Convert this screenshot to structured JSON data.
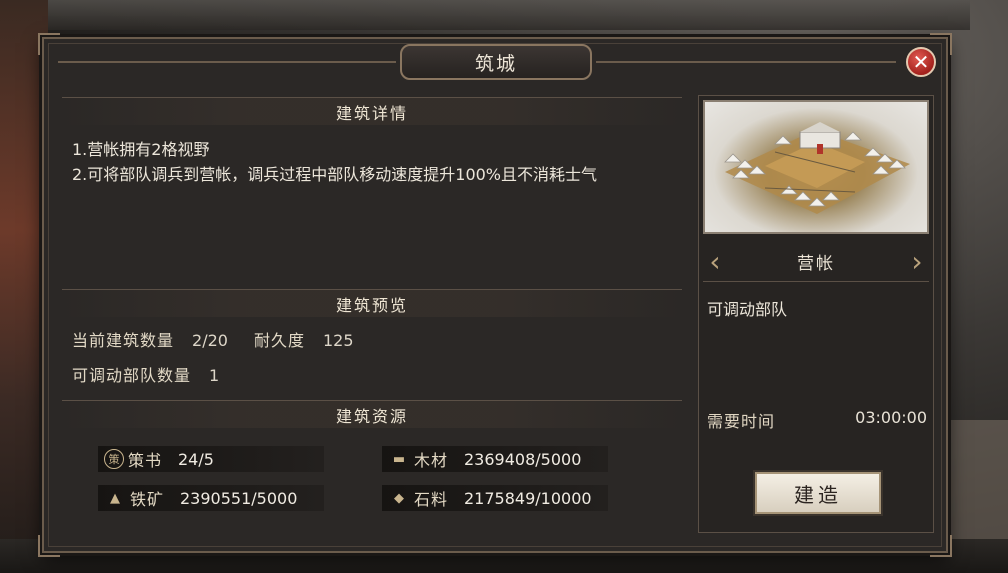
{
  "dialog": {
    "title": "筑城",
    "close_label": "✕"
  },
  "details": {
    "heading": "建筑详情",
    "lines": [
      "1.营帐拥有2格视野",
      "2.可将部队调兵到营帐，调兵过程中部队移动速度提升100%且不消耗士气"
    ]
  },
  "preview": {
    "heading": "建筑预览",
    "count_label": "当前建筑数量",
    "count_value": "2/20",
    "durability_label": "耐久度",
    "durability_value": "125",
    "troops_label": "可调动部队数量",
    "troops_value": "1"
  },
  "resources": {
    "heading": "建筑资源",
    "items": [
      {
        "icon": "decree-icon",
        "glyph": "策",
        "name": "策书",
        "value": "24/5"
      },
      {
        "icon": "wood-icon",
        "glyph": "▬",
        "name": "木材",
        "value": "2369408/5000"
      },
      {
        "icon": "iron-icon",
        "glyph": "▲",
        "name": "铁矿",
        "value": "2390551/5000"
      },
      {
        "icon": "stone-icon",
        "glyph": "◆",
        "name": "石料",
        "value": "2175849/10000"
      }
    ]
  },
  "building": {
    "name": "营帐",
    "description": "可调动部队",
    "time_label": "需要时间",
    "time_value": "03:00:00",
    "build_label": "建造",
    "prev_arrow": "‹",
    "next_arrow": "›"
  },
  "colors": {
    "panel": "#2b2826",
    "border": "#6b5c4c",
    "close": "#c2302b",
    "button": "#efe9dd"
  }
}
